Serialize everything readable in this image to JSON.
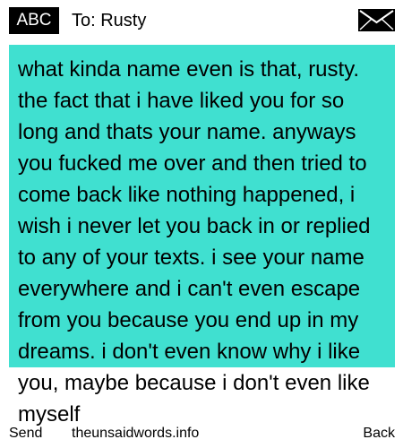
{
  "header": {
    "mode": "ABC",
    "recipient": "To: Rusty",
    "icon": "envelope-icon"
  },
  "message": {
    "text": "what kinda name even is that, rusty. the fact that i have liked you for so long and thats your name. anyways you fucked me over and then tried to come back like nothing happened, i wish i never let you back in or replied to any of your texts. i see your name everywhere and i can't even escape from you because you end up in my dreams. i don't even know why i like you, maybe because i don't even like myself",
    "highlight_color": "#40e0d0"
  },
  "footer": {
    "left": "Send",
    "center": "theunsaidwords.info",
    "right": "Back"
  }
}
